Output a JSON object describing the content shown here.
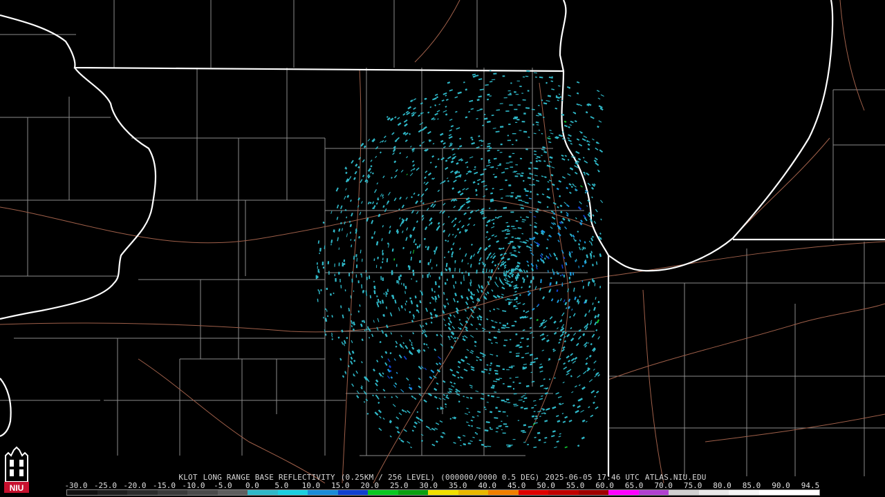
{
  "caption": {
    "station": "KLOT",
    "product": "LONG RANGE BASE REFLECTIVITY",
    "resolution": "(0.25KM / 256 LEVEL)",
    "volume": "(000000/0000 0.5 DEG)",
    "datetime": "2025-06-05 17:46 UTC",
    "source": "ATLAS.NIU.EDU"
  },
  "legend": {
    "ticks": [
      "-30.0",
      "-25.0",
      "-20.0",
      "-15.0",
      "-10.0",
      "-5.0",
      "0.0",
      "5.0",
      "10.0",
      "15.0",
      "20.0",
      "25.0",
      "30.0",
      "35.0",
      "40.0",
      "45.0",
      "50.0",
      "55.0",
      "60.0",
      "65.0",
      "70.0",
      "75.0",
      "80.0",
      "85.0",
      "90.0",
      "94.5"
    ],
    "colors": [
      "#111111",
      "#1e1e1e",
      "#2b2b2b",
      "#3a3a3a",
      "#4a4a4a",
      "#5e5e5e",
      "#2fb8c8",
      "#1ad0e0",
      "#1a8cd8",
      "#1040d0",
      "#08c820",
      "#0aa010",
      "#f0e000",
      "#e8b800",
      "#f08000",
      "#e00000",
      "#c00000",
      "#a00000",
      "#ff00ff",
      "#b040d0",
      "#d0d0d0",
      "#e8e8e8",
      "#f4f4f4",
      "#ffffff",
      "#ffffff"
    ]
  },
  "colors": {
    "background": "#000000",
    "state_border": "#ffffff",
    "county_line": "#8c8c8c",
    "highway": "#a0604a",
    "radar_light": "#2fb8c8",
    "radar_mid": "#1a9ce0",
    "radar_dark": "#1040d0",
    "radar_green": "#10c030"
  },
  "logo": {
    "text": "NIU",
    "color": "#c8102e",
    "icon": "niu-tower-logo"
  }
}
